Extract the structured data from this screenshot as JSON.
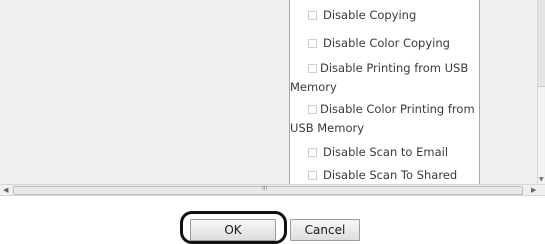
{
  "options": [
    {
      "first": "Disable Copying",
      "rest": ""
    },
    {
      "first": "Disable Color Copying",
      "rest": ""
    },
    {
      "first": "Disable Printing from USB",
      "rest": "Memory"
    },
    {
      "first": "Disable Color Printing from",
      "rest": "USB Memory"
    },
    {
      "first": "Disable Scan to Email",
      "rest": ""
    },
    {
      "first": "Disable Scan To Shared Folders",
      "rest": ""
    }
  ],
  "scrollbar": {
    "grip": "III"
  },
  "buttons": {
    "ok": "OK",
    "cancel": "Cancel"
  }
}
